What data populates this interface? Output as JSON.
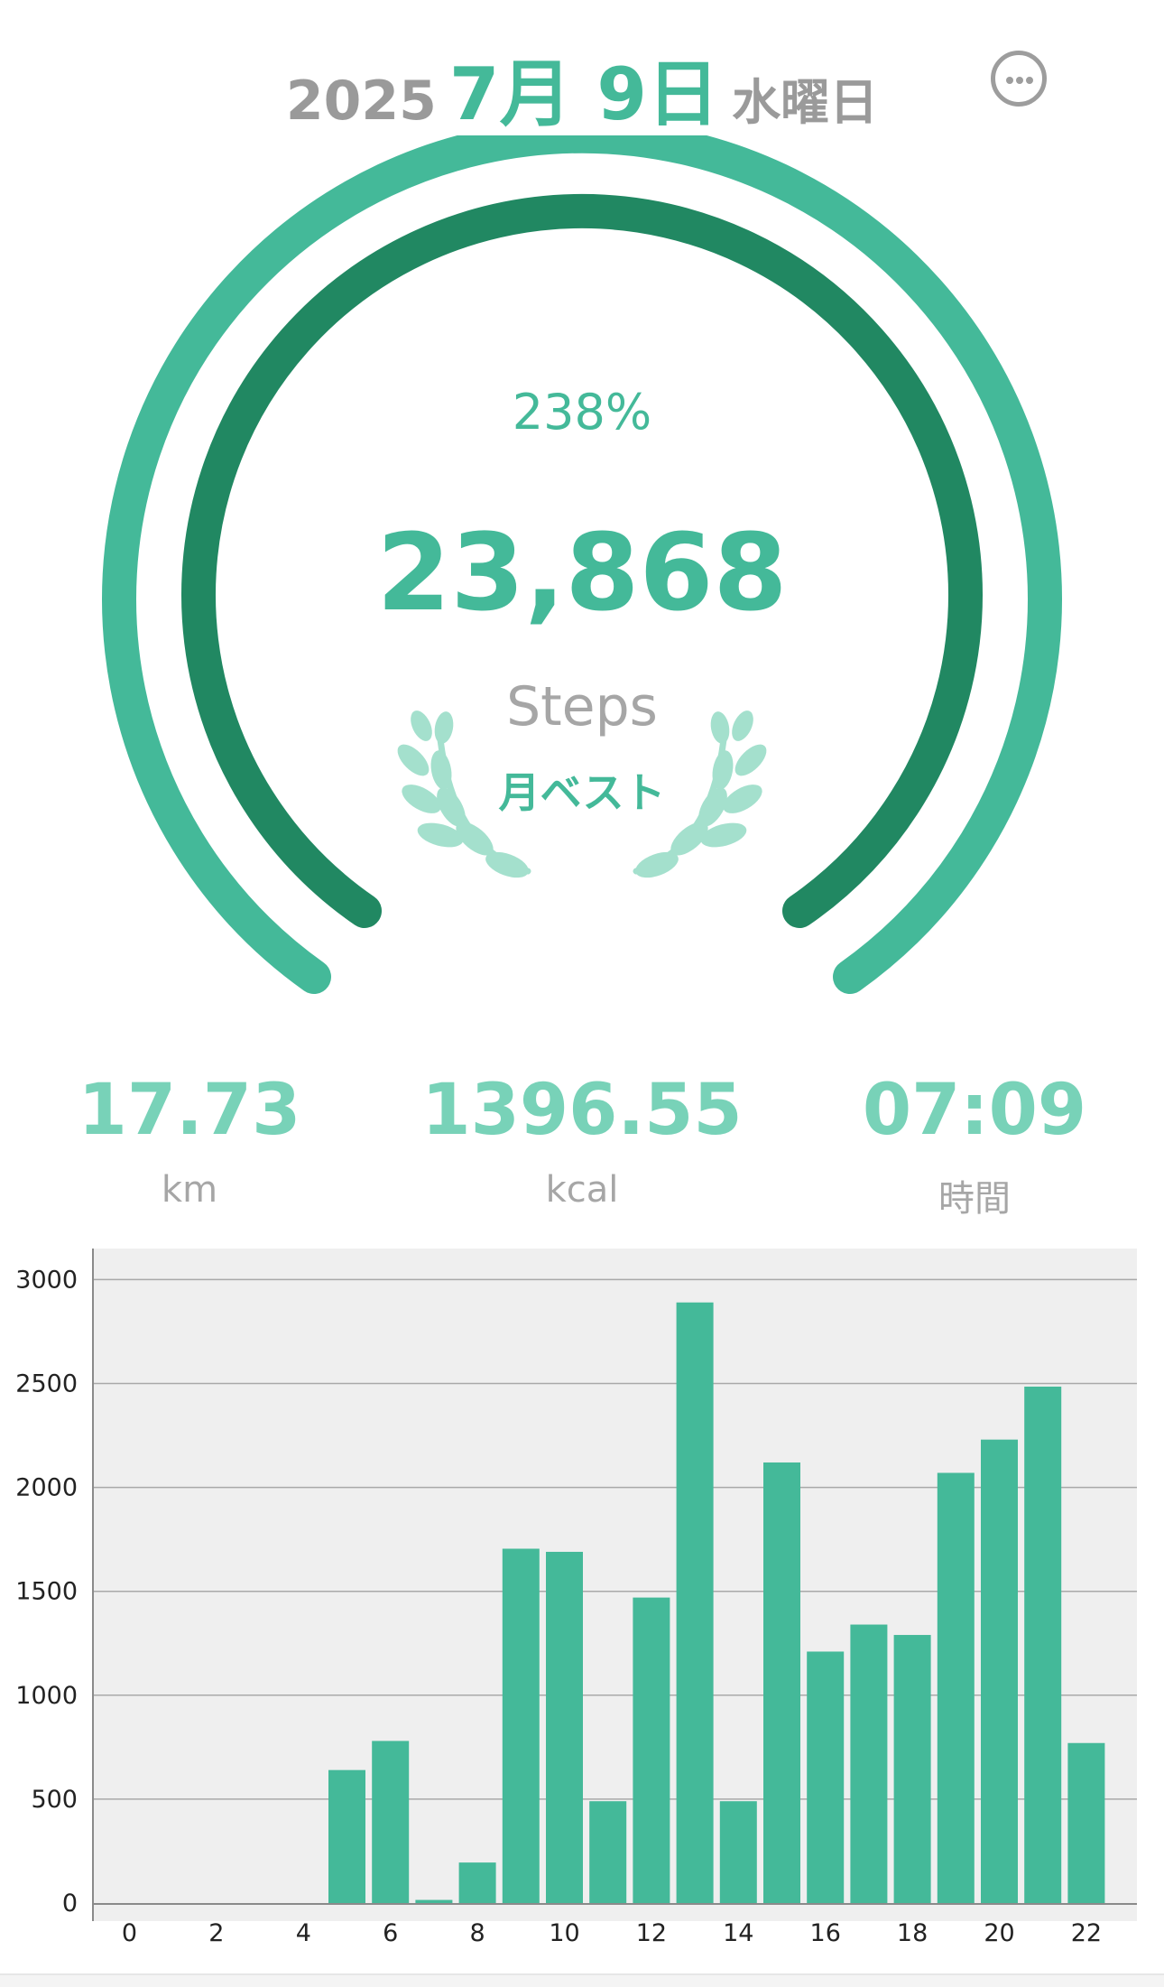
{
  "header": {
    "year": "2025",
    "month_day": "7月 9日",
    "weekday": "水曜日",
    "more_icon": "ellipsis-circle-icon"
  },
  "summary": {
    "percent": "238%",
    "steps": "23,868",
    "steps_label": "Steps",
    "best_badge": "月ベスト",
    "badge_icon": "laurel-wreath-icon",
    "goal_progress": 2.38
  },
  "stats": [
    {
      "value": "17.73",
      "unit": "km"
    },
    {
      "value": "1396.55",
      "unit": "kcal"
    },
    {
      "value": "07:09",
      "unit": "時間"
    }
  ],
  "colors": {
    "accent": "#44b999",
    "accent_dark": "#218862",
    "stat_value": "#78d2b8",
    "muted_text": "#9a9a9a",
    "chart_bg": "#efefef",
    "laurel": "#a4e0cd"
  },
  "chart_data": {
    "type": "bar",
    "x": [
      0,
      1,
      2,
      3,
      4,
      5,
      6,
      7,
      8,
      9,
      10,
      11,
      12,
      13,
      14,
      15,
      16,
      17,
      18,
      19,
      20,
      21,
      22,
      23
    ],
    "values": [
      0,
      0,
      0,
      0,
      0,
      640,
      780,
      15,
      195,
      1705,
      1690,
      490,
      1470,
      2890,
      490,
      2120,
      1210,
      1340,
      1290,
      2070,
      2230,
      2485,
      770,
      0
    ],
    "x_ticks": [
      "0",
      "2",
      "4",
      "6",
      "8",
      "10",
      "12",
      "14",
      "16",
      "18",
      "20",
      "22"
    ],
    "y_ticks": [
      "0",
      "500",
      "1000",
      "1500",
      "2000",
      "2500",
      "3000"
    ],
    "ylim": [
      0,
      3000
    ],
    "grid": true,
    "legend": "none",
    "title": "",
    "xlabel": "",
    "ylabel": ""
  }
}
